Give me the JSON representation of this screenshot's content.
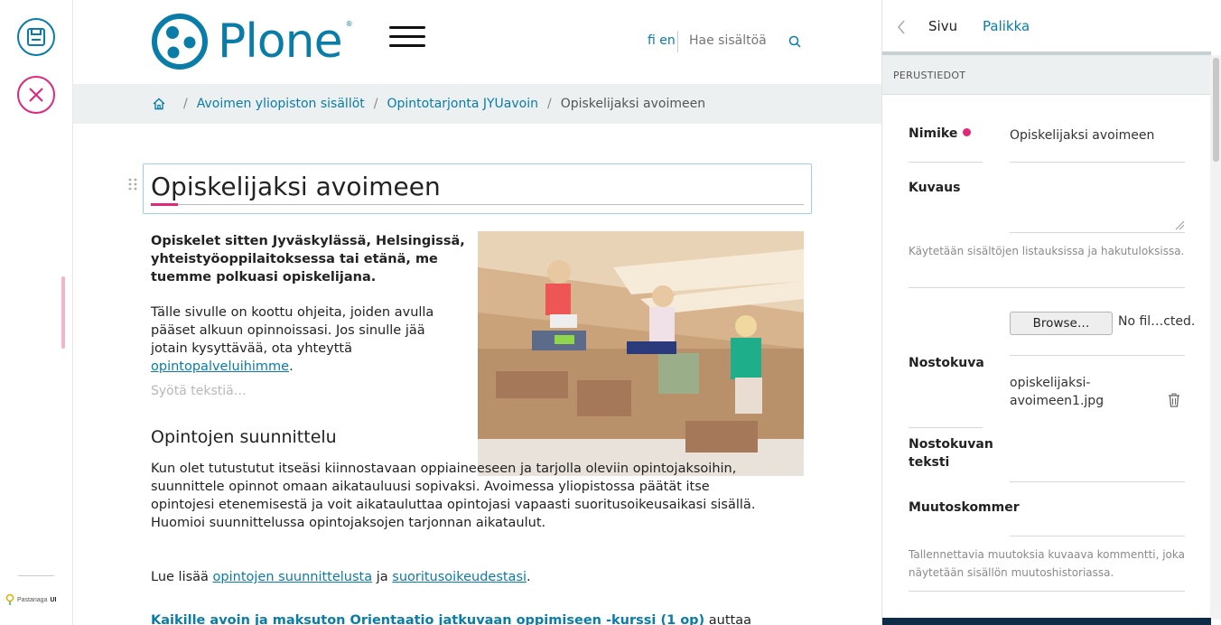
{
  "toolbar": {
    "save_icon": "floppy-disk-icon",
    "cancel_icon": "close-icon",
    "brand": "Pastanaga",
    "brand_suffix": "UI"
  },
  "header": {
    "logo_text": "Plone",
    "logo_reg": "®",
    "lang": "fi en",
    "search_placeholder": "Hae sisältöä"
  },
  "breadcrumb": {
    "items": [
      "Avoimen yliopiston sisällöt",
      "Opintotarjonta JYUavoin"
    ],
    "current": "Opiskelijaksi avoimeen",
    "separator": "/"
  },
  "content": {
    "title": "Opiskelijaksi avoimeen",
    "lead": "Opiskelet sitten Jyväskylässä, Helsingissä, yhteistyöoppilaitoksessa tai etänä, me tuemme polkuasi opiskelijana.",
    "para1_text": "Tälle sivulle on koottu ohjeita, joiden avulla pääset alkuun opinnoissasi. Jos sinulle jää jotain kysyttävää, ota yhteyttä ",
    "para1_link": "opintopalveluihimme",
    "para1_end": ".",
    "placeholder": "Syötä tekstiä…",
    "heading": "Opintojen suunnittelu",
    "para2": "Kun olet tutustutut itseäsi kiinnostavaan oppiaineeseen ja tarjolla oleviin opintojaksoihin, suunnittele opinnot omaan aikatauluusi sopivaksi. Avoimessa yliopistossa päätät itse opintojesi etenemisestä ja voit aikatauluttaa opintojasi vapaasti suoritusoikeusaikasi sisällä. Huomioi suunnittelussa opintojaksojen tarjonnan aikataulut.",
    "para3_start": "Lue lisää ",
    "para3_link1": "opintojen suunnittelusta",
    "para3_mid": " ja ",
    "para3_link2": "suoritusoikeudestasi",
    "para3_end": ".",
    "para4_link": "Kaikille avoin ja maksuton Orientaatio jatkuvaan oppimiseen -kurssi (1 op)",
    "para4_end": " auttaa"
  },
  "sidebar": {
    "tabs": [
      "Sivu",
      "Palikka"
    ],
    "section": "PERUSTIEDOT",
    "fields": {
      "title_label": "Nimike",
      "title_value": "Opiskelijaksi avoimeen",
      "description_label": "Kuvaus",
      "description_help": "Käytetään sisältöjen listauksissa ja hakutuloksissa.",
      "browse_label": "Browse…",
      "no_file": "No fil…cted.",
      "image_label": "Nostokuva",
      "image_file": "opiskelijaksi-avoimeen1.jpg",
      "image_caption_label": "Nostokuvan teksti",
      "changenote_label": "Muutoskommer",
      "changenote_help": "Tallennettavia muutoksia kuvaava kommentti, joka näytetään sisällön muutoshistoriassa."
    }
  },
  "colors": {
    "accent": "#0a7ca8",
    "pink": "#e0287b",
    "breadcrumb_bg": "#ecf0f1"
  }
}
